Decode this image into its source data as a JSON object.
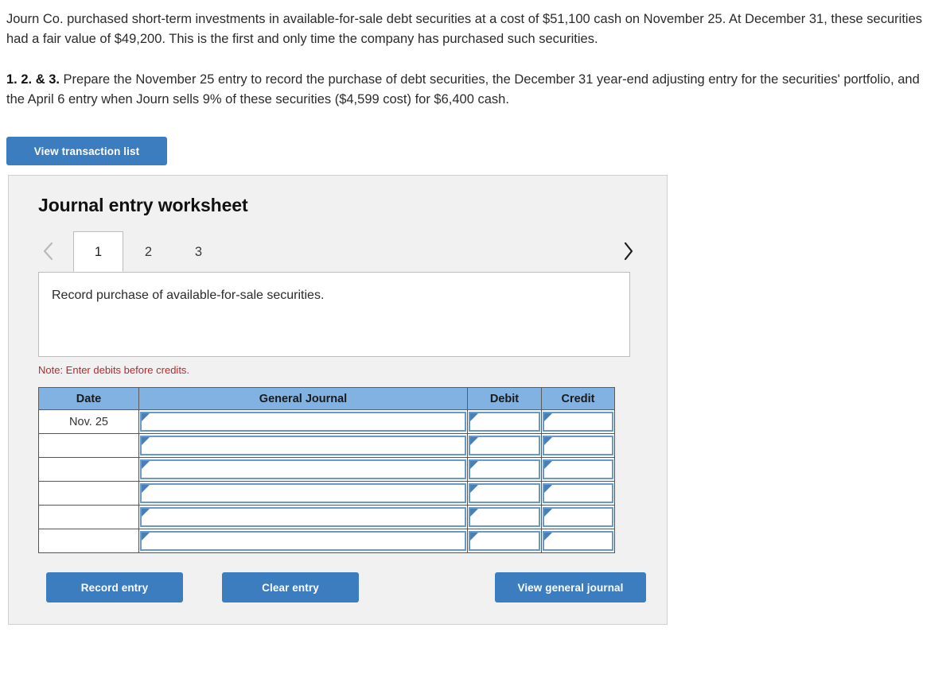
{
  "problem": {
    "paragraph_1": "Journ Co. purchased short-term investments in available-for-sale debt securities at a cost of $51,100 cash on November 25. At December 31, these securities had a fair value of $49,200. This is the first and only time the company has purchased such securities.",
    "requirement_prefix": "1. 2. & 3.",
    "requirement_text": " Prepare the November 25 entry to record the purchase of debt securities, the December 31 year-end adjusting entry for the securities' portfolio, and the April 6 entry when Journ sells 9% of these securities ($4,599 cost) for $6,400 cash."
  },
  "toolbar": {
    "view_transaction_list_label": "View transaction list"
  },
  "worksheet": {
    "title": "Journal entry worksheet",
    "prev_icon": "chevron-left-icon",
    "next_icon": "chevron-right-icon",
    "tabs": [
      {
        "label": "1",
        "active": true
      },
      {
        "label": "2",
        "active": false
      },
      {
        "label": "3",
        "active": false
      }
    ],
    "description": "Record purchase of available-for-sale securities.",
    "note": "Note: Enter debits before credits."
  },
  "journal_table": {
    "columns": [
      "Date",
      "General Journal",
      "Debit",
      "Credit"
    ],
    "rows": [
      {
        "date": "Nov. 25",
        "general_journal": "",
        "debit": "",
        "credit": ""
      },
      {
        "date": "",
        "general_journal": "",
        "debit": "",
        "credit": ""
      },
      {
        "date": "",
        "general_journal": "",
        "debit": "",
        "credit": ""
      },
      {
        "date": "",
        "general_journal": "",
        "debit": "",
        "credit": ""
      },
      {
        "date": "",
        "general_journal": "",
        "debit": "",
        "credit": ""
      },
      {
        "date": "",
        "general_journal": "",
        "debit": "",
        "credit": ""
      }
    ]
  },
  "actions": {
    "record_entry_label": "Record entry",
    "clear_entry_label": "Clear entry",
    "view_general_journal_label": "View general journal"
  },
  "colors": {
    "button_blue": "#3c7dc0",
    "table_header_blue": "#81b2e2",
    "input_border_blue": "#6699cc",
    "note_red": "#b52a2a",
    "panel_bg": "#f1f1f1"
  }
}
